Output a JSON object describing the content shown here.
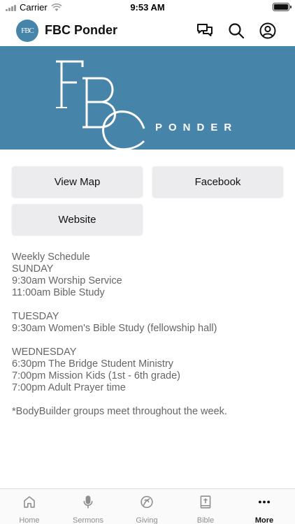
{
  "status_bar": {
    "carrier": "Carrier",
    "time": "9:53 AM",
    "battery_level": 1.0
  },
  "header": {
    "avatar_text": "FBC",
    "title": "FBC Ponder"
  },
  "banner": {
    "logo_text": "FBC PONDER"
  },
  "buttons": {
    "view_map": "View Map",
    "facebook": "Facebook",
    "website": "Website"
  },
  "schedule": {
    "title": "Weekly Schedule",
    "sunday": {
      "day": "SUNDAY",
      "items": [
        "9:30am Worship Service",
        "11:00am Bible Study"
      ]
    },
    "tuesday": {
      "day": "TUESDAY",
      "items": [
        "9:30am Women's Bible Study (fellowship hall)"
      ]
    },
    "wednesday": {
      "day": "WEDNESDAY",
      "items": [
        "6:30pm The Bridge Student Ministry",
        "7:00pm Mission Kids (1st - 6th grade)",
        "7:00pm Adult Prayer time"
      ]
    },
    "note": "*BodyBuilder groups meet throughout the week."
  },
  "tabs": [
    {
      "label": "Home",
      "icon": "home-icon"
    },
    {
      "label": "Sermons",
      "icon": "microphone-icon"
    },
    {
      "label": "Giving",
      "icon": "giving-icon"
    },
    {
      "label": "Bible",
      "icon": "bible-icon"
    },
    {
      "label": "More",
      "icon": "more-icon",
      "active": true
    }
  ],
  "colors": {
    "brand": "#4684a9",
    "button_bg": "#ececee",
    "text_muted": "#666666"
  }
}
